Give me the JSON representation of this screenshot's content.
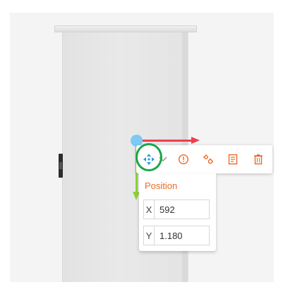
{
  "toolbar": {
    "buttons": [
      {
        "name": "move",
        "icon": "move-arrows-icon"
      },
      {
        "name": "mode-dropdown",
        "icon": "chevron-down-icon"
      },
      {
        "name": "info",
        "icon": "info-circle-icon"
      },
      {
        "name": "settings",
        "icon": "gears-icon"
      },
      {
        "name": "document",
        "icon": "document-icon"
      },
      {
        "name": "delete",
        "icon": "trash-icon"
      }
    ],
    "accent_color": "#ea6b28",
    "move_icon_color": "#2d9cdb"
  },
  "position_panel": {
    "title": "Position",
    "x_label": "X",
    "x_value": "592",
    "y_label": "Y",
    "y_value": "1.180"
  },
  "gizmo": {
    "x_axis_color": "#f03d4c",
    "y_axis_color": "#8fd03a",
    "origin_color": "#7ccaf5"
  },
  "highlight_color": "#1aa64b"
}
